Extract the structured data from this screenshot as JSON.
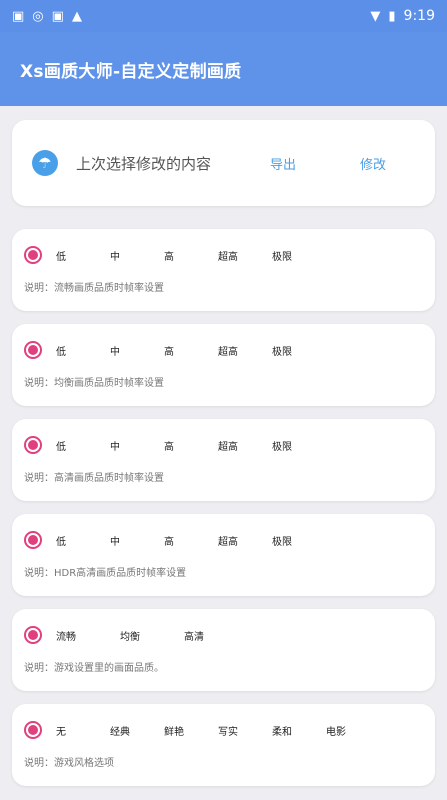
{
  "status_bar": {
    "time": "9:19",
    "left_icons": [
      "notification-icon",
      "location-icon",
      "notification-icon",
      "shopping-bag-icon"
    ],
    "right_icons": [
      "wifi-icon",
      "battery-icon"
    ]
  },
  "app_bar": {
    "title": "Xs画质大师-自定义定制画质"
  },
  "last_change": {
    "label": "上次选择修改的内容",
    "export_label": "导出",
    "modify_label": "修改"
  },
  "accent_color": "#e0407e",
  "option_groups": [
    {
      "options": [
        "低",
        "中",
        "高",
        "超高",
        "极限"
      ],
      "description": "说明：流畅画质品质时帧率设置"
    },
    {
      "options": [
        "低",
        "中",
        "高",
        "超高",
        "极限"
      ],
      "description": "说明：均衡画质品质时帧率设置"
    },
    {
      "options": [
        "低",
        "中",
        "高",
        "超高",
        "极限"
      ],
      "description": "说明：高清画质品质时帧率设置"
    },
    {
      "options": [
        "低",
        "中",
        "高",
        "超高",
        "极限"
      ],
      "description": "说明：HDR高清画质品质时帧率设置"
    },
    {
      "options": [
        "流畅",
        "均衡",
        "高清"
      ],
      "description": "说明：游戏设置里的画面品质。"
    },
    {
      "options": [
        "无",
        "经典",
        "鲜艳",
        "写实",
        "柔和",
        "电影"
      ],
      "description": "说明：游戏风格选项"
    }
  ]
}
